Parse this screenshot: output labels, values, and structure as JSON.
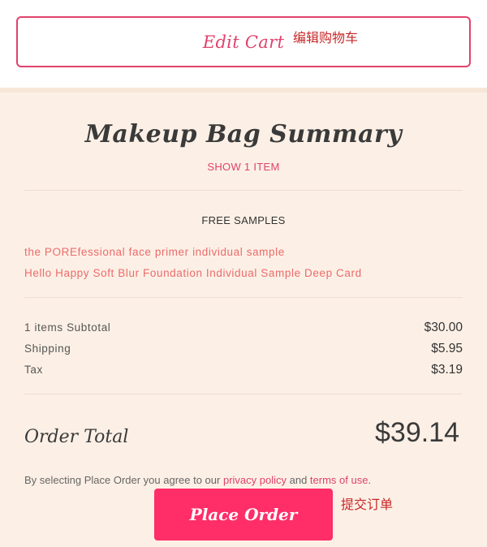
{
  "cart": {
    "edit_label": "Edit Cart",
    "edit_annotation": "编辑购物车"
  },
  "summary": {
    "title": "Makeup Bag Summary",
    "show_items": "SHOW 1 ITEM",
    "samples_heading": "FREE SAMPLES",
    "samples": [
      "the POREfessional face primer individual sample",
      "Hello Happy Soft Blur Foundation Individual Sample Deep Card"
    ],
    "lines": [
      {
        "label": "1 items Subtotal",
        "value": "$30.00"
      },
      {
        "label": "Shipping",
        "value": "$5.95"
      },
      {
        "label": "Tax",
        "value": "$3.19"
      }
    ],
    "total_label": "Order Total",
    "total_value": "$39.14"
  },
  "terms": {
    "prefix": "By selecting Place Order you agree to our ",
    "privacy": "privacy policy",
    "and": " and ",
    "terms": "terms of use",
    "suffix": "."
  },
  "order": {
    "place_label": "Place Order",
    "place_annotation": "提交订单"
  },
  "colors": {
    "accent": "#e0426c",
    "button": "#ff2d68",
    "panel": "#fcf0e6"
  }
}
